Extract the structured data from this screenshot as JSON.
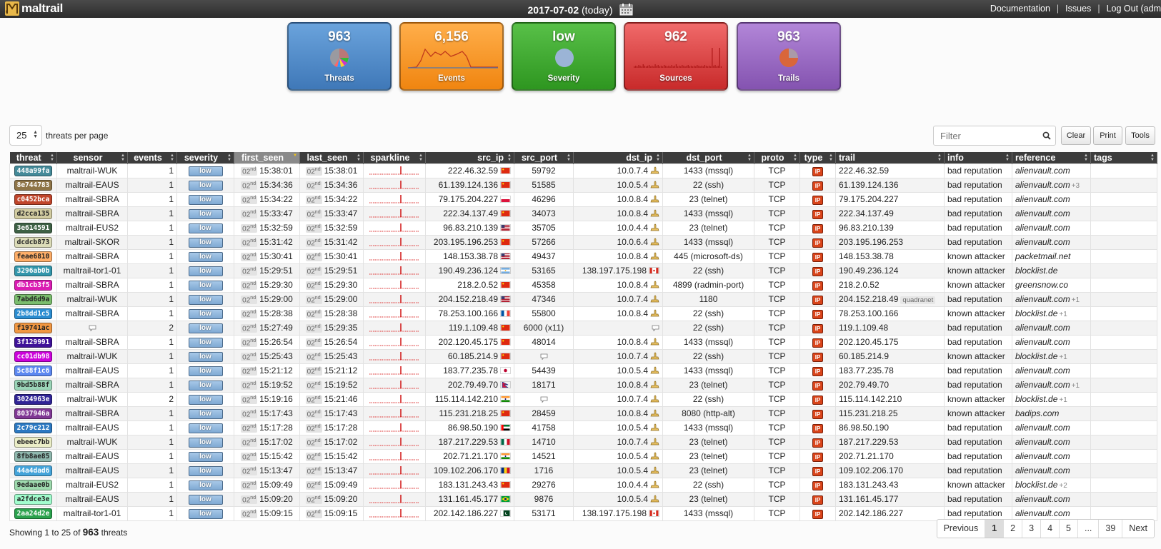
{
  "topbar": {
    "logo_text": "maltrail",
    "date": "2017-07-02",
    "today": "(today)",
    "links": [
      "Documentation",
      "Issues",
      "Log Out (adm"
    ]
  },
  "tiles": [
    {
      "value": "963",
      "label": "Threats",
      "color": "#4a84c4"
    },
    {
      "value": "6,156",
      "label": "Events",
      "color": "#f28c1c"
    },
    {
      "value": "low",
      "label": "Severity",
      "color": "#3c9e2c"
    },
    {
      "value": "962",
      "label": "Sources",
      "color": "#d23232"
    },
    {
      "value": "963",
      "label": "Trails",
      "color": "#9460b8"
    }
  ],
  "controls": {
    "per_page": "25",
    "per_page_label": "threats per page",
    "filter_placeholder": "Filter",
    "clear": "Clear",
    "print": "Print",
    "tools": "Tools"
  },
  "columns": [
    "threat",
    "sensor",
    "events",
    "severity",
    "first_seen",
    "last_seen",
    "sparkline",
    "src_ip",
    "src_port",
    "dst_ip",
    "dst_port",
    "proto",
    "type",
    "trail",
    "info",
    "reference",
    "tags"
  ],
  "rows": [
    {
      "threat": "448a99fa",
      "tcolor": "#448a99",
      "sensor": "maltrail-WUK",
      "events": "1",
      "severity": "low",
      "first": "15:38:01",
      "last": "15:38:01",
      "src_ip": "222.46.32.59",
      "flag": "cn",
      "src_port": "59792",
      "dst_ip": "10.0.7.4",
      "dflag": "local",
      "dst_port": "1433 (mssql)",
      "proto": "TCP",
      "type": "IP",
      "trail": "222.46.32.59",
      "trail_tag": "",
      "info": "bad reputation",
      "reference": "alienvault.com",
      "ref_more": "",
      "tags": ""
    },
    {
      "threat": "8e744783",
      "tcolor": "#8e7447",
      "sensor": "maltrail-EAUS",
      "events": "1",
      "severity": "low",
      "first": "15:34:36",
      "last": "15:34:36",
      "src_ip": "61.139.124.136",
      "flag": "cn",
      "src_port": "51585",
      "dst_ip": "10.0.5.4",
      "dflag": "local",
      "dst_port": "22 (ssh)",
      "proto": "TCP",
      "type": "IP",
      "trail": "61.139.124.136",
      "trail_tag": "",
      "info": "bad reputation",
      "reference": "alienvault.com",
      "ref_more": "+3",
      "tags": ""
    },
    {
      "threat": "c0452bca",
      "tcolor": "#c0452b",
      "sensor": "maltrail-SBRA",
      "events": "1",
      "severity": "low",
      "first": "15:34:22",
      "last": "15:34:22",
      "src_ip": "79.175.204.227",
      "flag": "pl",
      "src_port": "46296",
      "dst_ip": "10.0.8.4",
      "dflag": "local",
      "dst_port": "23 (telnet)",
      "proto": "TCP",
      "type": "IP",
      "trail": "79.175.204.227",
      "trail_tag": "",
      "info": "bad reputation",
      "reference": "alienvault.com",
      "ref_more": "",
      "tags": ""
    },
    {
      "threat": "d2cca135",
      "tcolor": "#d2cca1",
      "sensor": "maltrail-SBRA",
      "events": "1",
      "severity": "low",
      "first": "15:33:47",
      "last": "15:33:47",
      "src_ip": "222.34.137.49",
      "flag": "cn",
      "src_port": "34073",
      "dst_ip": "10.0.8.4",
      "dflag": "local",
      "dst_port": "1433 (mssql)",
      "proto": "TCP",
      "type": "IP",
      "trail": "222.34.137.49",
      "trail_tag": "",
      "info": "bad reputation",
      "reference": "alienvault.com",
      "ref_more": "",
      "tags": ""
    },
    {
      "threat": "3e614591",
      "tcolor": "#3e6145",
      "sensor": "maltrail-EUS2",
      "events": "1",
      "severity": "low",
      "first": "15:32:59",
      "last": "15:32:59",
      "src_ip": "96.83.210.139",
      "flag": "us",
      "src_port": "35705",
      "dst_ip": "10.0.4.4",
      "dflag": "local",
      "dst_port": "23 (telnet)",
      "proto": "TCP",
      "type": "IP",
      "trail": "96.83.210.139",
      "trail_tag": "",
      "info": "bad reputation",
      "reference": "alienvault.com",
      "ref_more": "",
      "tags": ""
    },
    {
      "threat": "dcdcb873",
      "tcolor": "#dcdcb8",
      "sensor": "maltrail-SKOR",
      "events": "1",
      "severity": "low",
      "first": "15:31:42",
      "last": "15:31:42",
      "src_ip": "203.195.196.253",
      "flag": "cn",
      "src_port": "57266",
      "dst_ip": "10.0.6.4",
      "dflag": "local",
      "dst_port": "1433 (mssql)",
      "proto": "TCP",
      "type": "IP",
      "trail": "203.195.196.253",
      "trail_tag": "",
      "info": "bad reputation",
      "reference": "alienvault.com",
      "ref_more": "",
      "tags": ""
    },
    {
      "threat": "feae6810",
      "tcolor": "#feae68",
      "sensor": "maltrail-SBRA",
      "events": "1",
      "severity": "low",
      "first": "15:30:41",
      "last": "15:30:41",
      "src_ip": "148.153.38.78",
      "flag": "us",
      "src_port": "49437",
      "dst_ip": "10.0.8.4",
      "dflag": "local",
      "dst_port": "445 (microsoft-ds)",
      "proto": "TCP",
      "type": "IP",
      "trail": "148.153.38.78",
      "trail_tag": "",
      "info": "known attacker",
      "reference": "packetmail.net",
      "ref_more": "",
      "tags": ""
    },
    {
      "threat": "3296ab0b",
      "tcolor": "#3296ab",
      "sensor": "maltrail-tor1-01",
      "events": "1",
      "severity": "low",
      "first": "15:29:51",
      "last": "15:29:51",
      "src_ip": "190.49.236.124",
      "flag": "ar",
      "src_port": "53165",
      "dst_ip": "138.197.175.198",
      "dflag": "ca",
      "dst_port": "22 (ssh)",
      "proto": "TCP",
      "type": "IP",
      "trail": "190.49.236.124",
      "trail_tag": "",
      "info": "known attacker",
      "reference": "blocklist.de",
      "ref_more": "",
      "tags": ""
    },
    {
      "threat": "db1cb3f5",
      "tcolor": "#db1cb3",
      "sensor": "maltrail-SBRA",
      "events": "1",
      "severity": "low",
      "first": "15:29:30",
      "last": "15:29:30",
      "src_ip": "218.2.0.52",
      "flag": "cn",
      "src_port": "45358",
      "dst_ip": "10.0.8.4",
      "dflag": "local",
      "dst_port": "4899 (radmin-port)",
      "proto": "TCP",
      "type": "IP",
      "trail": "218.2.0.52",
      "trail_tag": "",
      "info": "known attacker",
      "reference": "greensnow.co",
      "ref_more": "",
      "tags": ""
    },
    {
      "threat": "7abd6d9a",
      "tcolor": "#7abd6d",
      "sensor": "maltrail-WUK",
      "events": "1",
      "severity": "low",
      "first": "15:29:00",
      "last": "15:29:00",
      "src_ip": "204.152.218.49",
      "flag": "us",
      "src_port": "47346",
      "dst_ip": "10.0.7.4",
      "dflag": "local",
      "dst_port": "1180",
      "proto": "TCP",
      "type": "IP",
      "trail": "204.152.218.49",
      "trail_tag": "quadranet",
      "info": "bad reputation",
      "reference": "alienvault.com",
      "ref_more": "+1",
      "tags": ""
    },
    {
      "threat": "2b8dd1c5",
      "tcolor": "#2b8dd1",
      "sensor": "maltrail-SBRA",
      "events": "1",
      "severity": "low",
      "first": "15:28:38",
      "last": "15:28:38",
      "src_ip": "78.253.100.166",
      "flag": "fr",
      "src_port": "55800",
      "dst_ip": "10.0.8.4",
      "dflag": "local",
      "dst_port": "22 (ssh)",
      "proto": "TCP",
      "type": "IP",
      "trail": "78.253.100.166",
      "trail_tag": "",
      "info": "known attacker",
      "reference": "blocklist.de",
      "ref_more": "+1",
      "tags": ""
    },
    {
      "threat": "f19741ac",
      "tcolor": "#f19741",
      "sensor": "",
      "events": "2",
      "severity": "low",
      "first": "15:27:49",
      "last": "15:29:35",
      "src_ip": "119.1.109.48",
      "flag": "cn",
      "src_port": "6000 (x11)",
      "dst_ip": "",
      "dflag": "bubble",
      "dst_port": "22 (ssh)",
      "proto": "TCP",
      "type": "IP",
      "trail": "119.1.109.48",
      "trail_tag": "",
      "info": "bad reputation",
      "reference": "alienvault.com",
      "ref_more": "",
      "tags": ""
    },
    {
      "threat": "3f129991",
      "tcolor": "#3f1299",
      "sensor": "maltrail-SBRA",
      "events": "1",
      "severity": "low",
      "first": "15:26:54",
      "last": "15:26:54",
      "src_ip": "202.120.45.175",
      "flag": "cn",
      "src_port": "48014",
      "dst_ip": "10.0.8.4",
      "dflag": "local",
      "dst_port": "1433 (mssql)",
      "proto": "TCP",
      "type": "IP",
      "trail": "202.120.45.175",
      "trail_tag": "",
      "info": "bad reputation",
      "reference": "alienvault.com",
      "ref_more": "",
      "tags": ""
    },
    {
      "threat": "cc01db98",
      "tcolor": "#cc01db",
      "sensor": "maltrail-WUK",
      "events": "1",
      "severity": "low",
      "first": "15:25:43",
      "last": "15:25:43",
      "src_ip": "60.185.214.9",
      "flag": "cn",
      "src_port": "",
      "dst_ip": "10.0.7.4",
      "dflag": "local",
      "dst_port": "22 (ssh)",
      "proto": "TCP",
      "type": "IP",
      "trail": "60.185.214.9",
      "trail_tag": "",
      "info": "known attacker",
      "reference": "blocklist.de",
      "ref_more": "+1",
      "tags": ""
    },
    {
      "threat": "5c88f1c6",
      "tcolor": "#5c88f1",
      "sensor": "maltrail-EAUS",
      "events": "1",
      "severity": "low",
      "first": "15:21:12",
      "last": "15:21:12",
      "src_ip": "183.77.235.78",
      "flag": "jp",
      "src_port": "54439",
      "dst_ip": "10.0.5.4",
      "dflag": "local",
      "dst_port": "1433 (mssql)",
      "proto": "TCP",
      "type": "IP",
      "trail": "183.77.235.78",
      "trail_tag": "",
      "info": "bad reputation",
      "reference": "alienvault.com",
      "ref_more": "",
      "tags": ""
    },
    {
      "threat": "9bd5b88f",
      "tcolor": "#9bd5b8",
      "sensor": "maltrail-SBRA",
      "events": "1",
      "severity": "low",
      "first": "15:19:52",
      "last": "15:19:52",
      "src_ip": "202.79.49.70",
      "flag": "np",
      "src_port": "18171",
      "dst_ip": "10.0.8.4",
      "dflag": "local",
      "dst_port": "23 (telnet)",
      "proto": "TCP",
      "type": "IP",
      "trail": "202.79.49.70",
      "trail_tag": "",
      "info": "bad reputation",
      "reference": "alienvault.com",
      "ref_more": "+1",
      "tags": ""
    },
    {
      "threat": "3024963e",
      "tcolor": "#302496",
      "sensor": "maltrail-WUK",
      "events": "2",
      "severity": "low",
      "first": "15:19:16",
      "last": "15:21:46",
      "src_ip": "115.114.142.210",
      "flag": "in",
      "src_port": "",
      "dst_ip": "10.0.7.4",
      "dflag": "local",
      "dst_port": "22 (ssh)",
      "proto": "TCP",
      "type": "IP",
      "trail": "115.114.142.210",
      "trail_tag": "",
      "info": "known attacker",
      "reference": "blocklist.de",
      "ref_more": "+1",
      "tags": ""
    },
    {
      "threat": "8037946a",
      "tcolor": "#803794",
      "sensor": "maltrail-SBRA",
      "events": "1",
      "severity": "low",
      "first": "15:17:43",
      "last": "15:17:43",
      "src_ip": "115.231.218.25",
      "flag": "cn",
      "src_port": "28459",
      "dst_ip": "10.0.8.4",
      "dflag": "local",
      "dst_port": "8080 (http-alt)",
      "proto": "TCP",
      "type": "IP",
      "trail": "115.231.218.25",
      "trail_tag": "",
      "info": "known attacker",
      "reference": "badips.com",
      "ref_more": "",
      "tags": ""
    },
    {
      "threat": "2c79c212",
      "tcolor": "#2c79c2",
      "sensor": "maltrail-EAUS",
      "events": "1",
      "severity": "low",
      "first": "15:17:28",
      "last": "15:17:28",
      "src_ip": "86.98.50.190",
      "flag": "ae",
      "src_port": "41758",
      "dst_ip": "10.0.5.4",
      "dflag": "local",
      "dst_port": "1433 (mssql)",
      "proto": "TCP",
      "type": "IP",
      "trail": "86.98.50.190",
      "trail_tag": "",
      "info": "bad reputation",
      "reference": "alienvault.com",
      "ref_more": "",
      "tags": ""
    },
    {
      "threat": "ebeec7bb",
      "tcolor": "#ebeec7",
      "sensor": "maltrail-WUK",
      "events": "1",
      "severity": "low",
      "first": "15:17:02",
      "last": "15:17:02",
      "src_ip": "187.217.229.53",
      "flag": "mx",
      "src_port": "14710",
      "dst_ip": "10.0.7.4",
      "dflag": "local",
      "dst_port": "23 (telnet)",
      "proto": "TCP",
      "type": "IP",
      "trail": "187.217.229.53",
      "trail_tag": "",
      "info": "bad reputation",
      "reference": "alienvault.com",
      "ref_more": "",
      "tags": ""
    },
    {
      "threat": "8fb8ae85",
      "tcolor": "#8fb8ae",
      "sensor": "maltrail-EAUS",
      "events": "1",
      "severity": "low",
      "first": "15:15:42",
      "last": "15:15:42",
      "src_ip": "202.71.21.170",
      "flag": "in",
      "src_port": "14521",
      "dst_ip": "10.0.5.4",
      "dflag": "local",
      "dst_port": "23 (telnet)",
      "proto": "TCP",
      "type": "IP",
      "trail": "202.71.21.170",
      "trail_tag": "",
      "info": "bad reputation",
      "reference": "alienvault.com",
      "ref_more": "",
      "tags": ""
    },
    {
      "threat": "44a4dad6",
      "tcolor": "#44a4da",
      "sensor": "maltrail-EAUS",
      "events": "1",
      "severity": "low",
      "first": "15:13:47",
      "last": "15:13:47",
      "src_ip": "109.102.206.170",
      "flag": "ro",
      "src_port": "1716",
      "dst_ip": "10.0.5.4",
      "dflag": "local",
      "dst_port": "23 (telnet)",
      "proto": "TCP",
      "type": "IP",
      "trail": "109.102.206.170",
      "trail_tag": "",
      "info": "bad reputation",
      "reference": "alienvault.com",
      "ref_more": "",
      "tags": ""
    },
    {
      "threat": "9edaae0b",
      "tcolor": "#9edaae",
      "sensor": "maltrail-EUS2",
      "events": "1",
      "severity": "low",
      "first": "15:09:49",
      "last": "15:09:49",
      "src_ip": "183.131.243.43",
      "flag": "cn",
      "src_port": "29276",
      "dst_ip": "10.0.4.4",
      "dflag": "local",
      "dst_port": "22 (ssh)",
      "proto": "TCP",
      "type": "IP",
      "trail": "183.131.243.43",
      "trail_tag": "",
      "info": "known attacker",
      "reference": "blocklist.de",
      "ref_more": "+2",
      "tags": ""
    },
    {
      "threat": "a2fdce3e",
      "tcolor": "#a2fdce",
      "sensor": "maltrail-EAUS",
      "events": "1",
      "severity": "low",
      "first": "15:09:20",
      "last": "15:09:20",
      "src_ip": "131.161.45.177",
      "flag": "br",
      "src_port": "9876",
      "dst_ip": "10.0.5.4",
      "dflag": "local",
      "dst_port": "23 (telnet)",
      "proto": "TCP",
      "type": "IP",
      "trail": "131.161.45.177",
      "trail_tag": "",
      "info": "bad reputation",
      "reference": "alienvault.com",
      "ref_more": "",
      "tags": ""
    },
    {
      "threat": "2aa24d2e",
      "tcolor": "#2aa24d",
      "sensor": "maltrail-tor1-01",
      "events": "1",
      "severity": "low",
      "first": "15:09:15",
      "last": "15:09:15",
      "src_ip": "202.142.186.227",
      "flag": "pk",
      "src_port": "53171",
      "dst_ip": "138.197.175.198",
      "dflag": "ca",
      "dst_port": "1433 (mssql)",
      "proto": "TCP",
      "type": "IP",
      "trail": "202.142.186.227",
      "trail_tag": "",
      "info": "bad reputation",
      "reference": "alienvault.com",
      "ref_more": "",
      "tags": ""
    }
  ],
  "day_label": "02",
  "day_suffix": "nd",
  "footer": {
    "showing_prefix": "Showing 1 to 25 of",
    "total": "963",
    "showing_suffix": "threats",
    "pages": [
      "Previous",
      "1",
      "2",
      "3",
      "4",
      "5",
      "...",
      "39",
      "Next"
    ],
    "active_page": "1"
  }
}
